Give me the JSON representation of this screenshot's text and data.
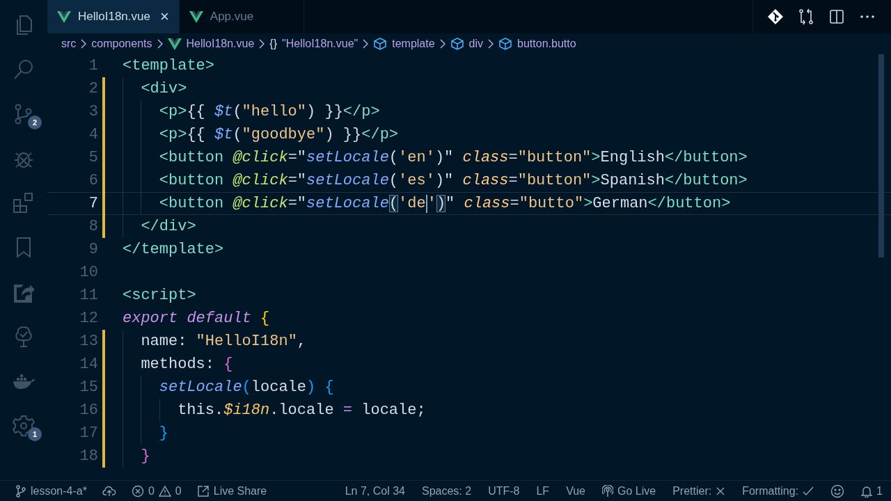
{
  "activity_bar": [
    {
      "kind": "explorer",
      "selected": false
    },
    {
      "kind": "search",
      "selected": false
    },
    {
      "kind": "source-control",
      "selected": false,
      "badge": "2"
    },
    {
      "kind": "debug",
      "selected": false
    },
    {
      "kind": "extensions",
      "selected": false
    },
    {
      "kind": "bookmark",
      "selected": false
    },
    {
      "kind": "share",
      "selected": false
    },
    {
      "kind": "tree",
      "selected": false
    },
    {
      "kind": "docker",
      "selected": false
    },
    {
      "kind": "settings",
      "selected": false,
      "badge": "1"
    }
  ],
  "tabs": [
    {
      "label": "HelloI18n.vue",
      "selected": true,
      "close": "×"
    },
    {
      "label": "App.vue",
      "selected": false
    }
  ],
  "breadcrumbs": [
    {
      "kind": "folder",
      "label": "src"
    },
    {
      "kind": "folder",
      "label": "components"
    },
    {
      "kind": "vue",
      "label": "HelloI18n.vue"
    },
    {
      "kind": "braces",
      "symbol": "{}",
      "label": "\"HelloI18n.vue\""
    },
    {
      "kind": "cube",
      "label": "template"
    },
    {
      "kind": "cube",
      "label": "div"
    },
    {
      "kind": "cube",
      "label": "button.butto"
    }
  ],
  "lines": [
    {
      "number": "1",
      "modified": false,
      "current": false,
      "tokens": [
        {
          "kind": "tag",
          "text": "<template>"
        }
      ]
    },
    {
      "number": "2",
      "modified": true,
      "current": false,
      "tokens": [
        {
          "kind": "tag",
          "text": "  <div>"
        }
      ]
    },
    {
      "number": "3",
      "modified": true,
      "current": false,
      "tokens": [
        {
          "kind": "tag",
          "text": "    <p>"
        },
        {
          "kind": "plain",
          "text": "{{ "
        },
        {
          "kind": "func",
          "text": "$t"
        },
        {
          "kind": "plain",
          "text": "("
        },
        {
          "kind": "string",
          "text": "\"hello\""
        },
        {
          "kind": "plain",
          "text": ") }}"
        },
        {
          "kind": "tag",
          "text": "</p>"
        }
      ]
    },
    {
      "number": "4",
      "modified": true,
      "current": false,
      "tokens": [
        {
          "kind": "tag",
          "text": "    <p>"
        },
        {
          "kind": "plain",
          "text": "{{ "
        },
        {
          "kind": "func",
          "text": "$t"
        },
        {
          "kind": "plain",
          "text": "("
        },
        {
          "kind": "string",
          "text": "\"goodbye\""
        },
        {
          "kind": "plain",
          "text": ") }}"
        },
        {
          "kind": "tag",
          "text": "</p>"
        }
      ]
    },
    {
      "number": "5",
      "modified": true,
      "current": false,
      "tokens": [
        {
          "kind": "tag",
          "text": "    <button "
        },
        {
          "kind": "attr",
          "text": "@click"
        },
        {
          "kind": "plain",
          "text": "=\""
        },
        {
          "kind": "func",
          "text": "setLocale"
        },
        {
          "kind": "plain",
          "text": "("
        },
        {
          "kind": "string",
          "text": "'en'"
        },
        {
          "kind": "plain",
          "text": ")\" "
        },
        {
          "kind": "attr2",
          "text": "class"
        },
        {
          "kind": "plain",
          "text": "="
        },
        {
          "kind": "string",
          "text": "\"button\""
        },
        {
          "kind": "tag",
          "text": ">"
        },
        {
          "kind": "plain",
          "text": "English"
        },
        {
          "kind": "tag",
          "text": "</button>"
        }
      ]
    },
    {
      "number": "6",
      "modified": true,
      "current": false,
      "tokens": [
        {
          "kind": "tag",
          "text": "    <button "
        },
        {
          "kind": "attr",
          "text": "@click"
        },
        {
          "kind": "plain",
          "text": "=\""
        },
        {
          "kind": "func",
          "text": "setLocale"
        },
        {
          "kind": "plain",
          "text": "("
        },
        {
          "kind": "string",
          "text": "'es'"
        },
        {
          "kind": "plain",
          "text": ")\" "
        },
        {
          "kind": "attr2",
          "text": "class"
        },
        {
          "kind": "plain",
          "text": "="
        },
        {
          "kind": "string",
          "text": "\"button\""
        },
        {
          "kind": "tag",
          "text": ">"
        },
        {
          "kind": "plain",
          "text": "Spanish"
        },
        {
          "kind": "tag",
          "text": "</button>"
        }
      ]
    },
    {
      "number": "7",
      "modified": true,
      "current": true,
      "tokens": [
        {
          "kind": "tag",
          "text": "    <button "
        },
        {
          "kind": "attr",
          "text": "@click"
        },
        {
          "kind": "plain",
          "text": "=\""
        },
        {
          "kind": "func",
          "text": "setLocale"
        },
        {
          "kind": "plain",
          "text": "(",
          "matched": true
        },
        {
          "kind": "string",
          "text": "'de",
          "cursor": true
        },
        {
          "kind": "string",
          "text": "'"
        },
        {
          "kind": "plain",
          "text": ")",
          "matched": true
        },
        {
          "kind": "plain",
          "text": "\" "
        },
        {
          "kind": "attr2",
          "text": "class"
        },
        {
          "kind": "plain",
          "text": "="
        },
        {
          "kind": "string",
          "text": "\"butto\""
        },
        {
          "kind": "tag",
          "text": ">"
        },
        {
          "kind": "plain",
          "text": "German"
        },
        {
          "kind": "tag",
          "text": "</button>"
        }
      ]
    },
    {
      "number": "8",
      "modified": true,
      "current": false,
      "tokens": [
        {
          "kind": "tag",
          "text": "  </div>"
        }
      ]
    },
    {
      "number": "9",
      "modified": false,
      "current": false,
      "tokens": [
        {
          "kind": "tag",
          "text": "</template>"
        }
      ]
    },
    {
      "number": "10",
      "modified": false,
      "current": false
    },
    {
      "number": "11",
      "modified": false,
      "current": false,
      "tokens": [
        {
          "kind": "tag",
          "text": "<script>"
        }
      ]
    },
    {
      "number": "12",
      "modified": false,
      "current": false,
      "tokens": [
        {
          "kind": "keyword",
          "text": "export default"
        },
        {
          "kind": "brace1",
          "text": " {"
        }
      ]
    },
    {
      "number": "13",
      "modified": true,
      "current": false,
      "tokens": [
        {
          "kind": "plain",
          "text": "  name: "
        },
        {
          "kind": "string",
          "text": "\"HelloI18n\""
        },
        {
          "kind": "plain",
          "text": ","
        }
      ]
    },
    {
      "number": "14",
      "modified": true,
      "current": false,
      "tokens": [
        {
          "kind": "plain",
          "text": "  methods: "
        },
        {
          "kind": "brace2",
          "text": "{"
        }
      ]
    },
    {
      "number": "15",
      "modified": true,
      "current": false,
      "tokens": [
        {
          "kind": "func",
          "text": "    setLocale"
        },
        {
          "kind": "brace3",
          "text": "("
        },
        {
          "kind": "plain",
          "text": "locale"
        },
        {
          "kind": "brace3",
          "text": ") {"
        }
      ]
    },
    {
      "number": "16",
      "modified": true,
      "current": false,
      "tokens": [
        {
          "kind": "plain",
          "text": "      this."
        },
        {
          "kind": "prop",
          "text": "$i18n"
        },
        {
          "kind": "plain",
          "text": ".locale "
        },
        {
          "kind": "op",
          "text": "="
        },
        {
          "kind": "plain",
          "text": " locale;"
        }
      ]
    },
    {
      "number": "17",
      "modified": true,
      "current": false,
      "tokens": [
        {
          "kind": "brace3",
          "text": "    }"
        }
      ]
    },
    {
      "number": "18",
      "modified": true,
      "current": false,
      "tokens": [
        {
          "kind": "brace2",
          "text": "  }"
        }
      ]
    }
  ],
  "status_left": [
    {
      "kind": "branch",
      "text": "lesson-4-a*"
    },
    {
      "kind": "sync"
    },
    {
      "kind": "problems",
      "errors": "0",
      "warnings": "0"
    },
    {
      "kind": "liveshare",
      "text": "Live Share"
    }
  ],
  "status_right": [
    {
      "kind": "text",
      "text": "Ln 7, Col 34"
    },
    {
      "kind": "text",
      "text": "Spaces: 2"
    },
    {
      "kind": "text",
      "text": "UTF-8"
    },
    {
      "kind": "text",
      "text": "LF"
    },
    {
      "kind": "text",
      "text": "Vue"
    },
    {
      "kind": "golive",
      "text": "Go Live"
    },
    {
      "kind": "cross",
      "text": "Prettier:"
    },
    {
      "kind": "check",
      "text": "Formatting:"
    },
    {
      "kind": "feedback"
    },
    {
      "kind": "bell",
      "text": "1"
    }
  ]
}
